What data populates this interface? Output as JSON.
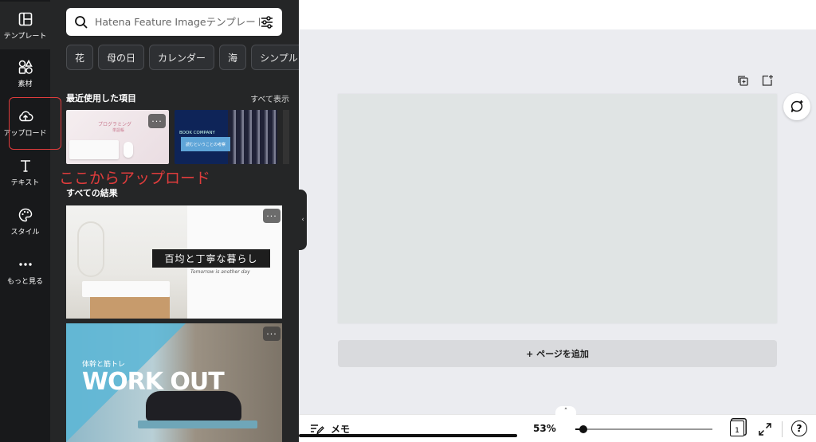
{
  "rail": {
    "items": [
      {
        "label": "テンプレート",
        "icon": "template-icon"
      },
      {
        "label": "素材",
        "icon": "elements-icon"
      },
      {
        "label": "アップロード",
        "icon": "cloud-upload-icon"
      },
      {
        "label": "テキスト",
        "icon": "text-icon"
      },
      {
        "label": "スタイル",
        "icon": "palette-icon"
      },
      {
        "label": "もっと見る",
        "icon": "more-dots-icon"
      }
    ]
  },
  "panel": {
    "search_placeholder": "Hatena Feature Imageテンプレート",
    "chips": [
      "花",
      "母の日",
      "カレンダー",
      "海",
      "シンプル"
    ],
    "recent_title": "最近使用した項目",
    "see_all": "すべて表示",
    "recent_thumbs": [
      {
        "title": "プログラミング",
        "subtitle": "単語帳"
      },
      {
        "company": "BOOK COMPANY",
        "caption": "読むということの考察"
      }
    ],
    "annotation": "ここからアップロード",
    "results_title": "すべての結果",
    "result1": {
      "banner": "百均と丁寧な暮らし",
      "script": "Tomorrow is another day"
    },
    "result2": {
      "small": "体幹と筋トレ",
      "big": "WORK OUT"
    },
    "more": "···"
  },
  "workspace": {
    "add_page": "+ ページを追加",
    "notes": "メモ",
    "zoom": "53%",
    "zoom_level": 0.53,
    "page_number": "1",
    "help": "?"
  },
  "colors": {
    "rail_bg": "#18191b",
    "panel_bg": "#252627",
    "annotation": "#e03c3c",
    "workspace_bg": "#ebecf0"
  }
}
